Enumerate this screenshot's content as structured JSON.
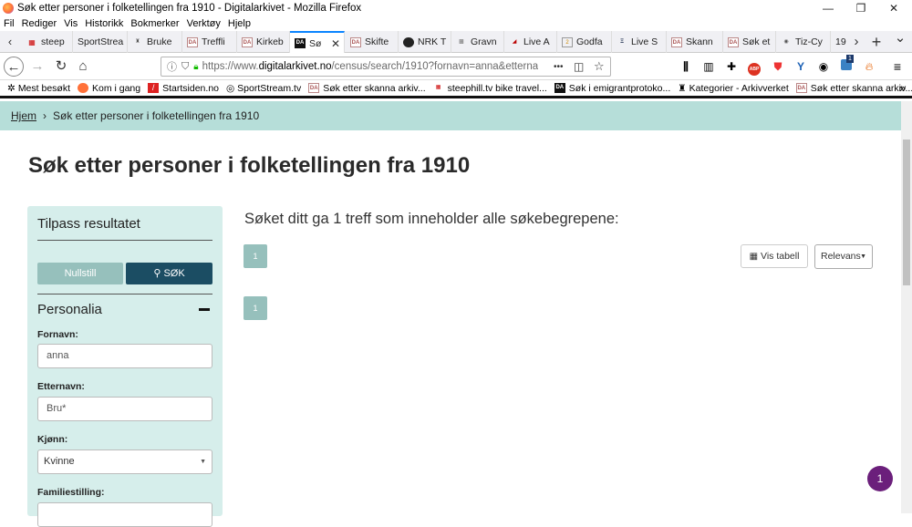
{
  "window": {
    "title": "Søk etter personer i folketellingen fra 1910 - Digitalarkivet - Mozilla Firefox",
    "min": "—",
    "restore": "❐",
    "close": "✕"
  },
  "menubar": [
    "Fil",
    "Rediger",
    "Vis",
    "Historikk",
    "Bokmerker",
    "Verktøy",
    "Hjelp"
  ],
  "tabs": [
    {
      "label": "steep"
    },
    {
      "label": "SportStrea"
    },
    {
      "label": "Bruke"
    },
    {
      "label": "Treffli"
    },
    {
      "label": "Kirkeb"
    },
    {
      "label": "Sø",
      "active": true
    },
    {
      "label": "Skifte"
    },
    {
      "label": "NRK T"
    },
    {
      "label": "Gravn"
    },
    {
      "label": "Live A"
    },
    {
      "label": "Godfa"
    },
    {
      "label": "Live S"
    },
    {
      "label": "Skann"
    },
    {
      "label": "Søk et"
    },
    {
      "label": "Tiz-Cy"
    },
    {
      "label": "19"
    }
  ],
  "tab_scroll_right": "›",
  "new_tab": "+",
  "tab_list": "⌄",
  "navbar": {
    "url_prefix": "https://www.",
    "url_domain": "digitalarkivet.no",
    "url_rest": "/census/search/1910?fornavn=anna&etterna",
    "more": "•••",
    "addon_badge": "1"
  },
  "bookmarks": [
    {
      "label": "Mest besøkt"
    },
    {
      "label": "Kom i gang"
    },
    {
      "label": "Startsiden.no"
    },
    {
      "label": "SportStream.tv"
    },
    {
      "label": "Søk etter skanna arkiv..."
    },
    {
      "label": "steephill.tv bike travel..."
    },
    {
      "label": "Søk i emigrantprotoko..."
    },
    {
      "label": "Kategorier - Arkivverket"
    },
    {
      "label": "Søk etter skanna arkiv..."
    }
  ],
  "breadcrumb": {
    "home": "Hjem",
    "sep": "›",
    "current": "Søk etter personer i folketellingen fra 1910"
  },
  "page": {
    "title": "Søk etter personer i folketellingen fra 1910",
    "result_text": "Søket ditt ga 1 treff som inneholder alle søkebegrepene:",
    "page_number": "1",
    "vis_tabell": "Vis tabell",
    "sort_value": "Relevans"
  },
  "sidebar": {
    "heading": "Tilpass resultatet",
    "reset_label": "Nullstill",
    "search_label": "SØK",
    "section": "Personalia",
    "fields": {
      "fornavn_label": "Fornavn:",
      "fornavn_value": "anna",
      "etternavn_label": "Etternavn:",
      "etternavn_value": "Bru*",
      "kjonn_label": "Kjønn:",
      "kjonn_value": "Kvinne",
      "familiestilling_label": "Familiestilling:"
    }
  },
  "notification_badge": "1"
}
